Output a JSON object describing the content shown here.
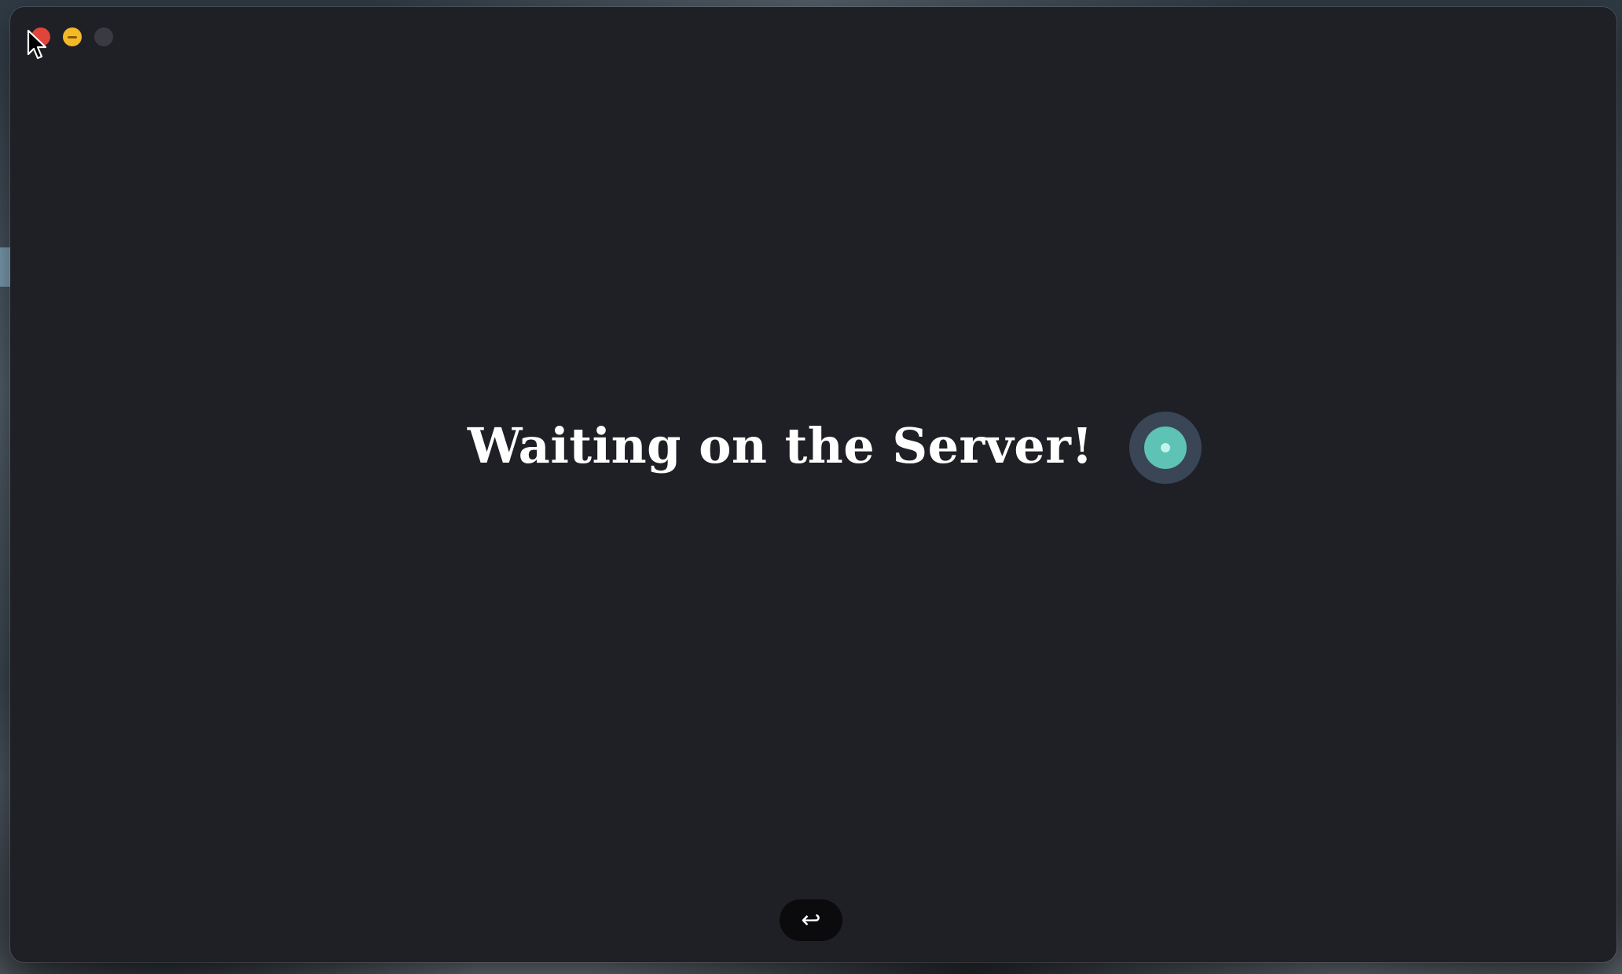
{
  "window": {
    "title_buttons": {
      "close_icon": "close-icon",
      "minimize_icon": "minimize-icon",
      "maximize_icon": "maximize-icon"
    }
  },
  "main": {
    "heading": "Waiting on the Server!",
    "spinner_icon": "loading-spinner-icon",
    "return_button": {
      "icon": "return-arrow-icon",
      "glyph": "↩"
    }
  },
  "colors": {
    "window_bg": "#1f1f26",
    "close": "#e0443a",
    "minimize": "#f5b928",
    "maximize": "#3a3a42",
    "spinner_outer": "#3a4656",
    "spinner_inner": "#5ec2b4",
    "spinner_dot": "#bff5ec",
    "button_bg": "#0b0b0e"
  }
}
